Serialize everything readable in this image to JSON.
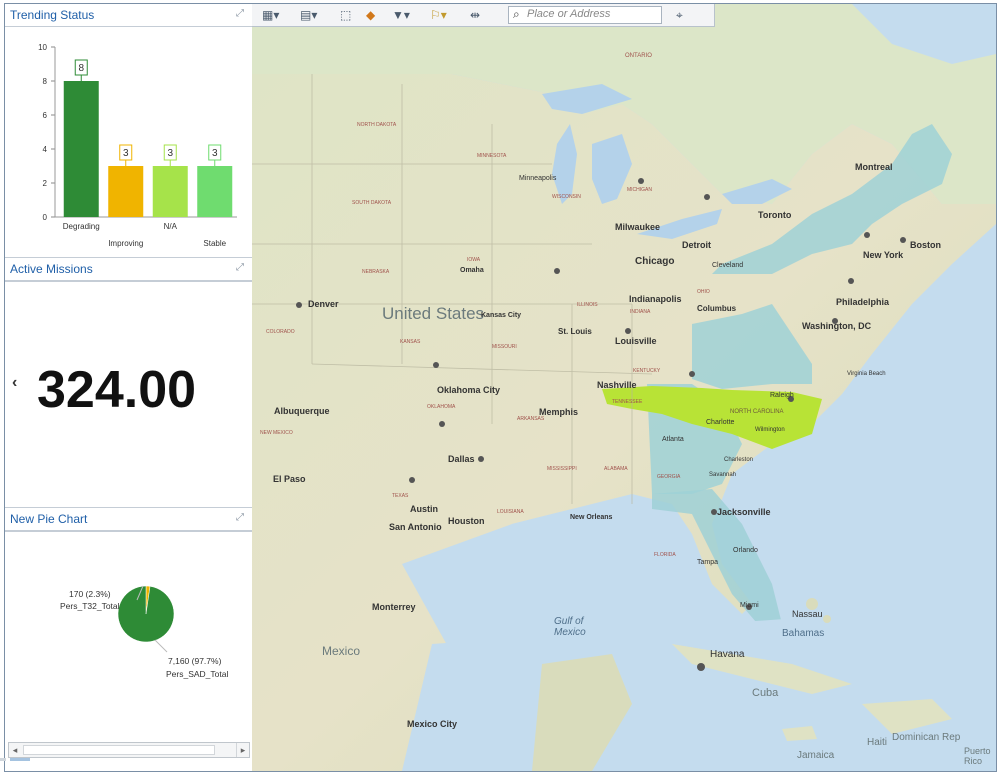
{
  "panels": {
    "trending": {
      "title": "Trending Status"
    },
    "missions": {
      "title": "Active Missions",
      "value": "324.00"
    },
    "pie": {
      "title": "New Pie Chart"
    }
  },
  "chart_data": [
    {
      "type": "bar",
      "categories": [
        "Degrading",
        "Improving",
        "N/A",
        "Stable"
      ],
      "values": [
        8,
        3,
        3,
        3
      ],
      "colors": [
        "#2e8b36",
        "#f0b400",
        "#a6e34a",
        "#6fdc6f"
      ],
      "ylim": [
        0,
        10
      ],
      "yticks": [
        "0",
        "2",
        "4",
        "6",
        "8",
        "10"
      ],
      "data_labels": [
        "8",
        "3",
        "3",
        "3"
      ]
    },
    {
      "type": "pie",
      "slices": [
        {
          "label": "Pers_T32_Total",
          "value": 170,
          "display": "170 (2.3%)",
          "color": "#f0b400"
        },
        {
          "label": "Pers_SAD_Total",
          "value": 7160,
          "display": "7,160 (97.7%)",
          "color": "#2e8b36"
        }
      ]
    }
  ],
  "toolbar": {
    "search_placeholder": "Place or Address"
  },
  "map": {
    "labels": {
      "country": "United States",
      "gulf": "Gulf of Mexico",
      "mexico": "Mexico",
      "bahamas": "Bahamas",
      "cuba": "Cuba",
      "havana": "Havana",
      "nassau": "Nassau",
      "haiti": "Haiti",
      "dominican": "Dominican Rep",
      "jamaica": "Jamaica",
      "puerto": "Puerto Rico",
      "ontario": "ONTARIO",
      "chicago": "Chicago",
      "detroit": "Detroit",
      "toronto": "Toronto",
      "montreal": "Montreal",
      "boston": "Boston",
      "newyork": "New York",
      "philadelphia": "Philadelphia",
      "washington": "Washington, DC",
      "raleigh": "Raleigh",
      "charlotte": "Charlotte",
      "atlanta": "Atlanta",
      "jacksonville": "Jacksonville",
      "miami": "Miami",
      "orlando": "Orlando",
      "tampa": "Tampa",
      "neworleans": "New Orleans",
      "houston": "Houston",
      "dallas": "Dallas",
      "sanantonio": "San Antonio",
      "austin": "Austin",
      "elpaso": "El Paso",
      "albuquerque": "Albuquerque",
      "denver": "Denver",
      "oklahoma": "Oklahoma City",
      "kansascity": "Kansas City",
      "stlouis": "St. Louis",
      "memphis": "Memphis",
      "nashville": "Nashville",
      "louisville": "Louisville",
      "indianapolis": "Indianapolis",
      "columbus": "Columbus",
      "cleveland": "Cleveland",
      "minneapolis": "Minneapolis",
      "milwaukee": "Milwaukee",
      "omaha": "Omaha",
      "monterrey": "Monterrey",
      "mexicocity": "Mexico City",
      "norfolk": "Virginia Beach",
      "wilmington": "Wilmington",
      "savannah": "Savannah",
      "charleston": "Charleston",
      "northcarolina": "NORTH CAROLINA",
      "nd": "NORTH DAKOTA",
      "sd": "SOUTH DAKOTA",
      "nebraska": "NEBRASKA",
      "kansas": "KANSAS",
      "colorado": "COLORADO",
      "newmexico": "NEW MEXICO",
      "texas": "TEXAS",
      "oklahoma_st": "OKLAHOMA",
      "iowa": "IOWA",
      "missouri": "MISSOURI",
      "arkansas": "ARKANSAS",
      "mississippi": "MISSISSIPPI",
      "alabama": "ALABAMA",
      "tennessee": "TENNESSEE",
      "kentucky": "KENTUCKY",
      "minnesota": "MINNESOTA",
      "wisconsin": "WISCONSIN",
      "michigan": "MICHIGAN",
      "illinois": "ILLINOIS",
      "indiana": "INDIANA",
      "ohio": "OHIO",
      "florida": "FLORIDA",
      "georgia": "GEORGIA",
      "louisiana": "LOUISIANA"
    }
  }
}
